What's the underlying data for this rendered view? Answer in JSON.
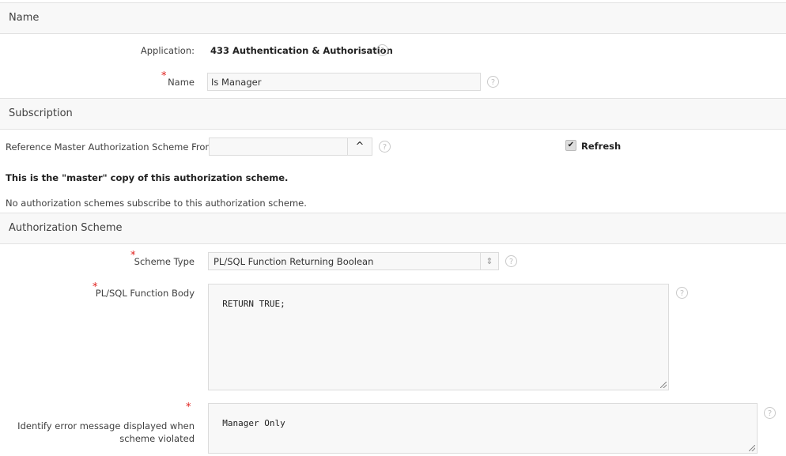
{
  "sections": {
    "name": "Name",
    "subscription": "Subscription",
    "authorization_scheme": "Authorization Scheme"
  },
  "name_section": {
    "application_label": "Application:",
    "application_value": "433 Authentication & Authorisation",
    "name_label": "Name",
    "name_value": "Is Manager"
  },
  "subscription_section": {
    "reference_label": "Reference Master Authorization Scheme From",
    "reference_value": "",
    "refresh_label": "Refresh",
    "refresh_checked": true,
    "master_note": "This is the \"master\" copy of this authorization scheme.",
    "subscribers_note": "No authorization schemes subscribe to this authorization scheme."
  },
  "auth_section": {
    "scheme_type_label": "Scheme Type",
    "scheme_type_value": "PL/SQL Function Returning Boolean",
    "function_body_label": "PL/SQL Function Body",
    "function_body_value": "RETURN TRUE;",
    "error_message_label": "Identify error message displayed when scheme violated",
    "error_message_value": "Manager Only"
  },
  "icons": {
    "help": "?",
    "required": "*",
    "popup_up": "^",
    "select_arrows": "⇕",
    "check": "✔"
  }
}
